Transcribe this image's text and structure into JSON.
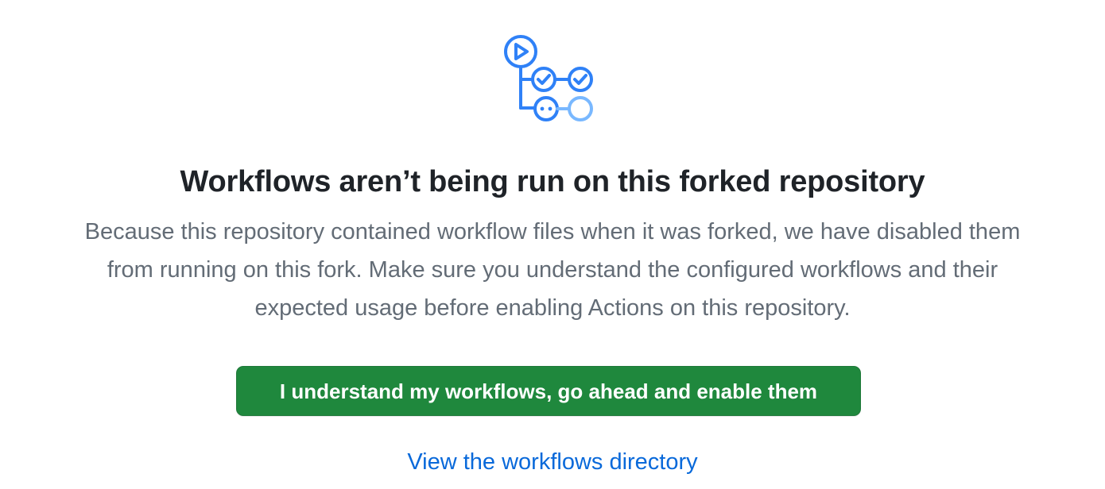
{
  "blankslate": {
    "icon": "github-actions-workflow-icon",
    "title": "Workflows aren’t being run on this forked repository",
    "description_lines": [
      "Because this repository contained workflow files when it was forked, we have disabled them",
      "from running on this fork. Make sure you understand the configured workflows and their",
      "expected usage before enabling Actions on this repository."
    ],
    "enable_button_label": "I understand my workflows, go ahead and enable them",
    "view_link_label": "View the workflows directory"
  },
  "colors": {
    "icon_blue": "#2f81f7",
    "icon_light_blue": "#79b8ff",
    "button_green": "#1f883d",
    "link_blue": "#0969da",
    "muted_text": "#636c76",
    "title_text": "#1f2328"
  }
}
